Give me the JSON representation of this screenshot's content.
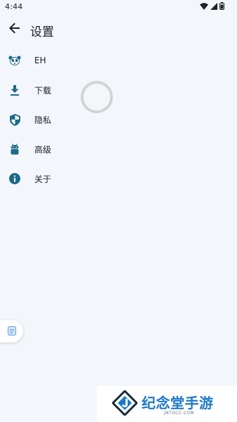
{
  "status_bar": {
    "time": "4:44"
  },
  "header": {
    "title": "设置"
  },
  "menu": {
    "items": [
      {
        "label": "EH",
        "icon": "panda-icon"
      },
      {
        "label": "下载",
        "icon": "download-icon"
      },
      {
        "label": "隐私",
        "icon": "shield-icon"
      },
      {
        "label": "高级",
        "icon": "android-icon"
      },
      {
        "label": "关于",
        "icon": "info-icon"
      }
    ]
  },
  "watermark": {
    "text": "纪念堂手游",
    "domain": "JNTDCC.COM"
  },
  "colors": {
    "accent": "#1e6a8a",
    "background": "#f3f7fb",
    "spinner": "#d2d3d5",
    "watermark": "#1e78c8"
  }
}
